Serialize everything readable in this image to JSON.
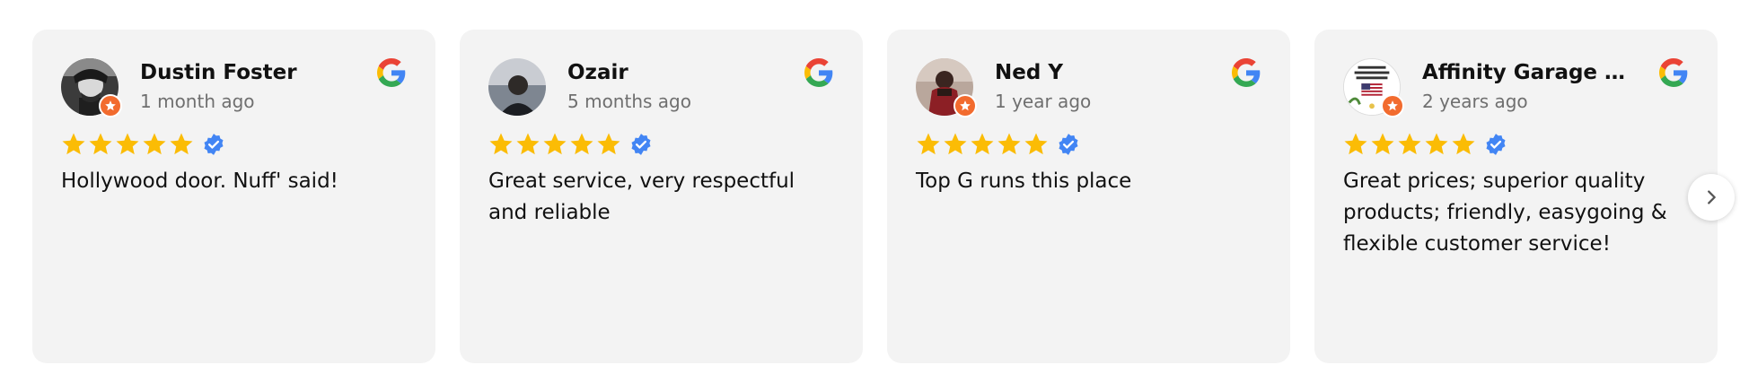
{
  "reviews": [
    {
      "name": "Dustin Foster",
      "time": "1 month ago",
      "rating": 5,
      "text": "Hollywood door. Nuff' said!",
      "avatar_color": "#5a5a5a"
    },
    {
      "name": "Ozair",
      "time": "5 months ago",
      "rating": 5,
      "text": "Great service, very respectful and reliable",
      "avatar_color": "#4b4f55"
    },
    {
      "name": "Ned Y",
      "time": "1 year ago",
      "rating": 5,
      "text": "Top G runs this place",
      "avatar_color": "#6b3b32"
    },
    {
      "name": "Affinity Garage Doo…",
      "time": "2 years ago",
      "rating": 5,
      "text": "Great prices; superior quality products; friendly, easygoing & flexible customer service!",
      "avatar_color": "#ffffff"
    }
  ],
  "colors": {
    "card_bg": "#f3f3f3",
    "star": "#fbbc05",
    "verified": "#4285f4",
    "badge": "#f26b2e",
    "muted_text": "#6f6f6f"
  },
  "icons": {
    "source": "google-icon",
    "star": "star-icon",
    "verified": "verified-badge-icon",
    "next": "chevron-right-icon"
  }
}
